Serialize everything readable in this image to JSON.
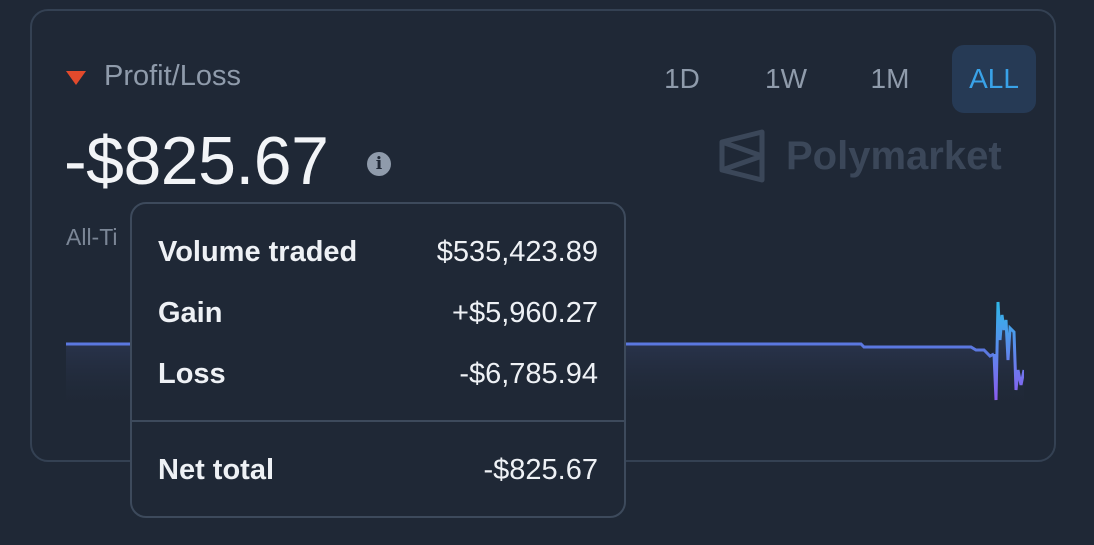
{
  "header": {
    "label": "Profit/Loss"
  },
  "tabs": [
    {
      "label": "1D",
      "active": false
    },
    {
      "label": "1W",
      "active": false
    },
    {
      "label": "1M",
      "active": false
    },
    {
      "label": "ALL",
      "active": true
    }
  ],
  "pnl": {
    "value": "-$825.67",
    "info_icon": "info-icon"
  },
  "logo": {
    "text": "Polymarket"
  },
  "subtitle": "All-Ti",
  "tooltip": {
    "rows": [
      {
        "label": "Volume traded",
        "value": "$535,423.89"
      },
      {
        "label": "Gain",
        "value": "+$5,960.27"
      },
      {
        "label": "Loss",
        "value": "-$6,785.94"
      }
    ],
    "total": {
      "label": "Net total",
      "value": "-$825.67"
    }
  },
  "colors": {
    "background": "#1f2836",
    "accent": "#39a2e8",
    "negative": "#e24a2c",
    "line": "#5b78e0"
  }
}
